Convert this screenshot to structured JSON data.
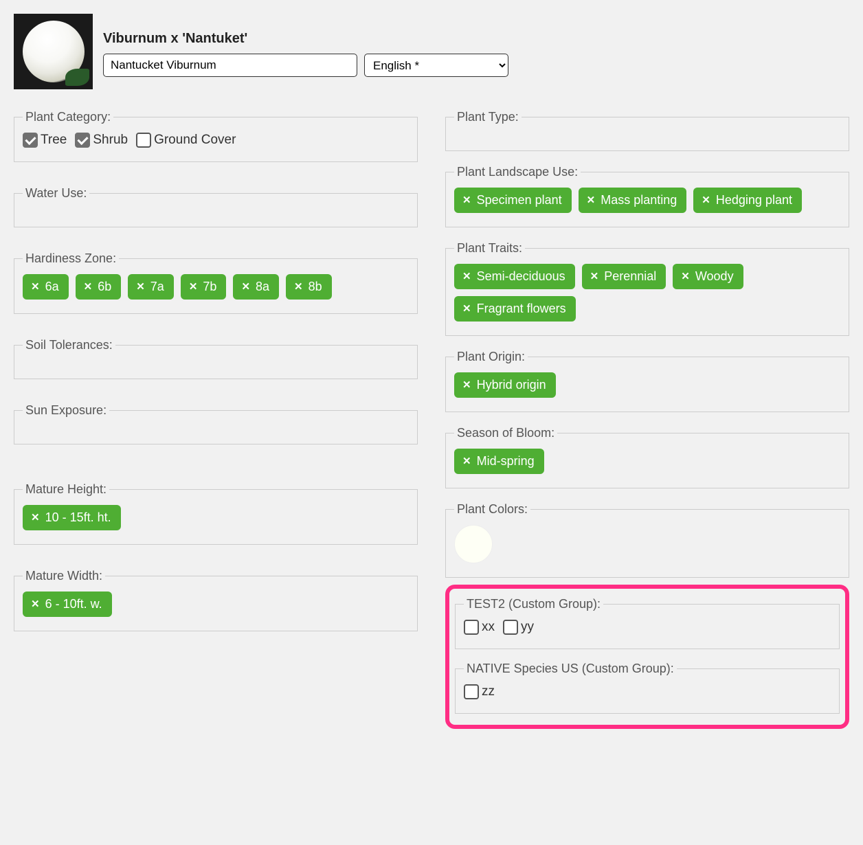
{
  "header": {
    "title": "Viburnum x 'Nantuket'",
    "name_value": "Nantucket Viburnum",
    "language": "English *"
  },
  "plant_category": {
    "legend": "Plant Category:",
    "options": [
      {
        "label": "Tree",
        "checked": true
      },
      {
        "label": "Shrub",
        "checked": true
      },
      {
        "label": "Ground Cover",
        "checked": false
      }
    ]
  },
  "water_use": {
    "legend": "Water Use:"
  },
  "hardiness_zone": {
    "legend": "Hardiness Zone:",
    "tags": [
      "6a",
      "6b",
      "7a",
      "7b",
      "8a",
      "8b"
    ]
  },
  "soil_tolerances": {
    "legend": "Soil Tolerances:"
  },
  "sun_exposure": {
    "legend": "Sun Exposure:"
  },
  "mature_height": {
    "legend": "Mature Height:",
    "tags": [
      "10 - 15ft. ht."
    ]
  },
  "mature_width": {
    "legend": "Mature Width:",
    "tags": [
      "6 - 10ft. w."
    ]
  },
  "plant_type": {
    "legend": "Plant Type:"
  },
  "plant_landscape_use": {
    "legend": "Plant Landscape Use:",
    "tags": [
      "Specimen plant",
      "Mass planting",
      "Hedging plant"
    ]
  },
  "plant_traits": {
    "legend": "Plant Traits:",
    "tags": [
      "Semi-deciduous",
      "Perennial",
      "Woody",
      "Fragrant flowers"
    ]
  },
  "plant_origin": {
    "legend": "Plant Origin:",
    "tags": [
      "Hybrid origin"
    ]
  },
  "season_of_bloom": {
    "legend": "Season of Bloom:",
    "tags": [
      "Mid-spring"
    ]
  },
  "plant_colors": {
    "legend": "Plant Colors:",
    "colors": [
      "#fefff5"
    ]
  },
  "custom_test2": {
    "legend": "TEST2 (Custom Group):",
    "options": [
      {
        "label": "xx",
        "checked": false
      },
      {
        "label": "yy",
        "checked": false
      }
    ]
  },
  "custom_native": {
    "legend": "NATIVE Species US (Custom Group):",
    "options": [
      {
        "label": "zz",
        "checked": false
      }
    ]
  }
}
